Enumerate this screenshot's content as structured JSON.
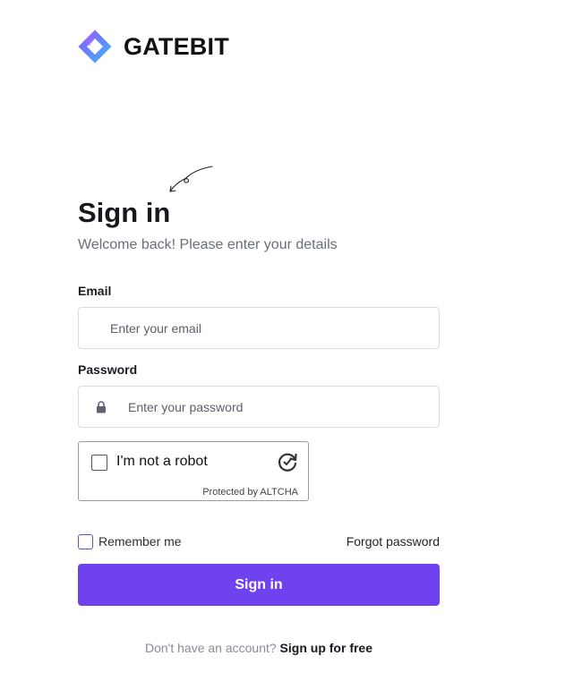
{
  "brand": {
    "name": "GATEBIT",
    "logo_icon": "diamond-logo-icon",
    "colors": {
      "logo_start": "#7b5cf5",
      "logo_end": "#3fb6ff"
    }
  },
  "heading": {
    "title": "Sign in",
    "subtitle": "Welcome back! Please enter your details"
  },
  "email": {
    "label": "Email",
    "placeholder": "Enter your email",
    "value": ""
  },
  "password": {
    "label": "Password",
    "placeholder": "Enter your password",
    "value": "",
    "icon": "lock-icon"
  },
  "captcha": {
    "label": "I'm not a robot",
    "footer": "Protected by ALTCHA",
    "checked": false,
    "icon": "altcha-refresh-icon"
  },
  "options": {
    "remember_label": "Remember me",
    "remember_checked": false,
    "forgot_label": "Forgot password"
  },
  "submit": {
    "label": "Sign in",
    "color": "#6f42ef"
  },
  "signup": {
    "prompt": "Don't have an account?",
    "link": "Sign up for free"
  },
  "decor": {
    "doodle_icon": "curly-arrow-icon"
  }
}
